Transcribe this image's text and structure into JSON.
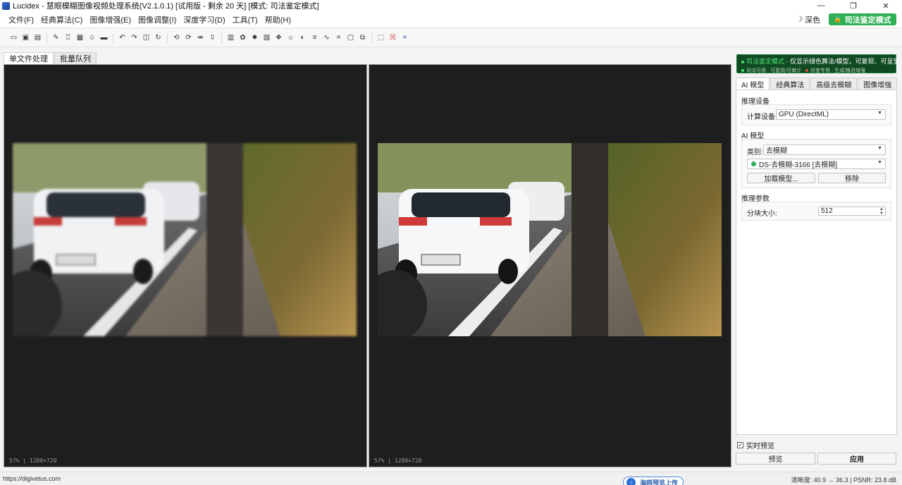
{
  "window": {
    "title": "Lucidex - 慧眼模糊图像视频处理系统(V2.1.0.1)  [试用版 - 剩余 20 天]  [模式: 司法鉴定模式]",
    "controls": {
      "minimize": "—",
      "maximize": "❐",
      "close": "✕"
    }
  },
  "menu": {
    "items": [
      "文件(F)",
      "经典算法(C)",
      "图像增强(E)",
      "图像调整(I)",
      "深度学习(D)",
      "工具(T)",
      "帮助(H)"
    ],
    "theme_label": "深色",
    "forensic_button": "司法鉴定模式"
  },
  "toolbar": {
    "icons": [
      "new-file-icon",
      "open-folder-icon",
      "save-icon",
      "separator",
      "magic-wand-icon",
      "trophy-icon",
      "badge-icon",
      "smile-icon",
      "ruler-icon",
      "separator",
      "undo-icon",
      "redo-icon",
      "compare-icon",
      "refresh-icon",
      "separator",
      "rotate-left-icon",
      "rotate-right-icon",
      "flip-horizontal-icon",
      "flip-vertical-icon",
      "separator",
      "histogram-icon",
      "palette-icon",
      "sharpen-icon",
      "image-icon",
      "denoise-icon",
      "brightness-icon",
      "contrast-icon",
      "levels-icon",
      "curves-icon",
      "crop-icon",
      "frame-icon",
      "layers-icon",
      "separator",
      "select-icon",
      "clear-selection-icon",
      "crop-tool-icon"
    ]
  },
  "tabs": {
    "single": "单文件处理",
    "batch": "批量队列"
  },
  "panes": {
    "left_info": "57% | 1280×720",
    "right_info": "57% | 1280×720"
  },
  "mode_banner": {
    "title": "司法鉴定模式",
    "description": "· 仅显示绿色算法/模型，可复现、可呈堂",
    "legend_green": "司法可用 · 可复现/可审计",
    "legend_red": "侦查专用 · 生成/推进增强",
    "colors": {
      "green": "#51e07c",
      "red": "#e84a3c"
    }
  },
  "settings": {
    "tabs": [
      "AI 模型",
      "经典算法",
      "高级去模糊",
      "图像增强"
    ],
    "inference_device": {
      "title": "推理设备",
      "label": "计算设备:",
      "value": "GPU (DirectML)"
    },
    "ai_model": {
      "title": "AI 模型",
      "category_label": "类别:",
      "category_value": "去模糊",
      "model_value": "DS-去模糊-3166 [去模糊]",
      "load_button": "加载模型...",
      "remove_button": "移除"
    },
    "inference_params": {
      "title": "推理参数",
      "tile_label": "分块大小:",
      "tile_value": "512"
    }
  },
  "preview": {
    "realtime_label": "实时预览",
    "realtime_checked": true,
    "preview_button": "预览",
    "apply_button": "应用"
  },
  "statusbar": {
    "url": "https://digivetus.com",
    "upload_label": "海鸥预览上传",
    "metrics": "清晰度: 40.9 → 36.3  |  PSNR: 23.8 dB"
  }
}
